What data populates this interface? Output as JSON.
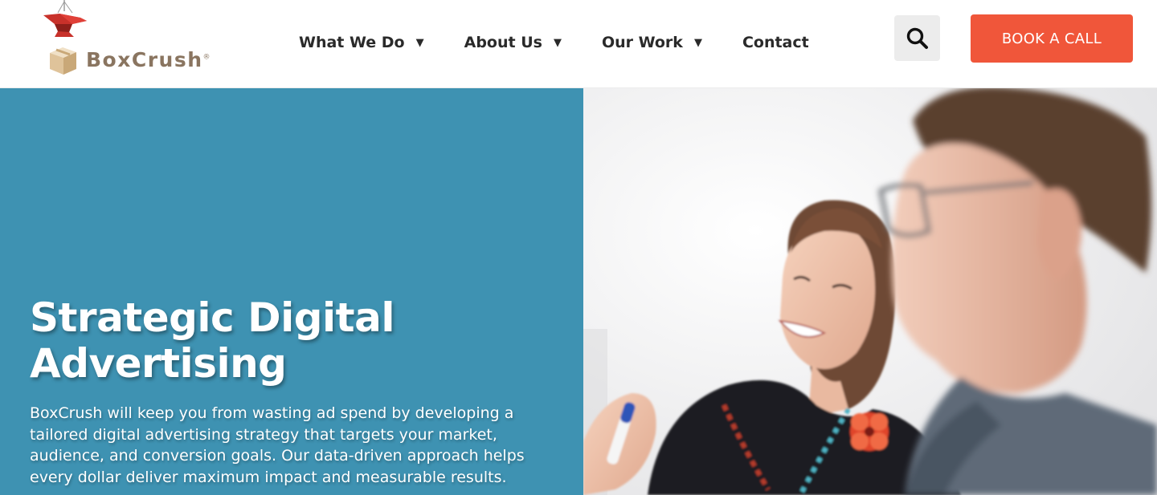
{
  "header": {
    "logo": {
      "brand": "BoxCrush",
      "wordmark": "BoxCrush",
      "registered": "®",
      "icon": "anvil-on-box-icon"
    },
    "nav": [
      {
        "label": "What We Do",
        "has_dropdown": true,
        "icon": "caret-down-icon"
      },
      {
        "label": "About Us",
        "has_dropdown": true,
        "icon": "caret-down-icon"
      },
      {
        "label": "Our Work",
        "has_dropdown": true,
        "icon": "caret-down-icon"
      },
      {
        "label": "Contact",
        "has_dropdown": false
      }
    ],
    "search": {
      "icon": "search-icon"
    },
    "cta": {
      "label": "BOOK A CALL"
    }
  },
  "hero": {
    "title_line1": "Strategic Digital",
    "title_line2": "Advertising",
    "description": "BoxCrush will keep you from wasting ad spend by developing a tailored digital advertising strategy that targets your market, audience, and conversion goals. Our data-driven approach helps every dollar deliver maximum impact and measurable results.",
    "image": "photo-two-people-smiling"
  },
  "colors": {
    "hero_bg": "#3e92b2",
    "cta_bg": "#f0563a",
    "cta_text": "#ffffff",
    "search_bg": "#ececec",
    "nav_text": "#2a2a2a",
    "logo_text": "#8a7560"
  }
}
